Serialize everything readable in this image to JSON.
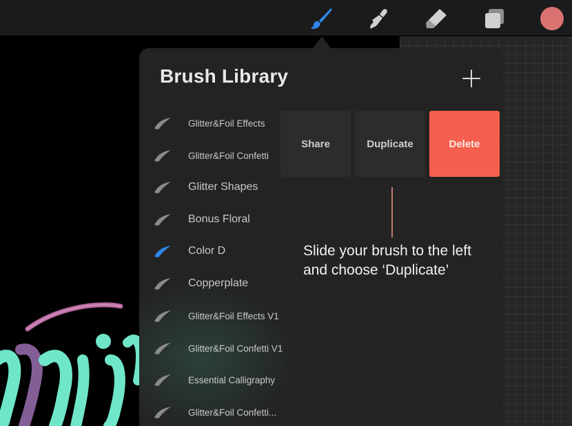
{
  "toolbar": {
    "tools": [
      {
        "name": "brush",
        "icon": "paintbrush-icon",
        "active": true
      },
      {
        "name": "smudge",
        "icon": "smudge-icon",
        "active": false
      },
      {
        "name": "eraser",
        "icon": "eraser-icon",
        "active": false
      },
      {
        "name": "layers",
        "icon": "layers-icon",
        "active": false
      }
    ],
    "current_color": "#d97372",
    "active_color": "#2f86e8"
  },
  "panel": {
    "title": "Brush Library",
    "add_icon": "plus-icon",
    "brushes": [
      {
        "label": "Glitter&Foil Effects",
        "selected": false
      },
      {
        "label": "Glitter&Foil Confetti",
        "selected": false
      },
      {
        "label": "Glitter Shapes",
        "selected": false
      },
      {
        "label": "Bonus Floral",
        "selected": false
      },
      {
        "label": "Color D",
        "selected": true
      },
      {
        "label": "Copperplate",
        "selected": false
      },
      {
        "label": "Glitter&Foil Effects V1",
        "selected": false
      },
      {
        "label": "Glitter&Foil Confetti V1",
        "selected": false
      },
      {
        "label": "Essential Calligraphy",
        "selected": false
      },
      {
        "label": "Glitter&Foil Confetti...",
        "selected": false
      }
    ],
    "actions": {
      "share": "Share",
      "duplicate": "Duplicate",
      "delete": "Delete"
    }
  },
  "annotation": {
    "text": "Slide your brush to the left and choose ‘Duplicate’"
  },
  "colors": {
    "delete": "#f4604d",
    "panel_bg": "#232323",
    "pointer": "#c27a6d",
    "selected_brush": "#2f86e8"
  }
}
